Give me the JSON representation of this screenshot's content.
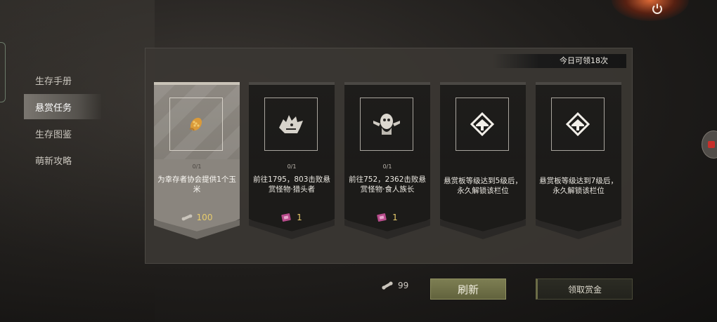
{
  "menu": {
    "items": [
      {
        "label": "生存手册",
        "active": false
      },
      {
        "label": "悬赏任务",
        "active": true
      },
      {
        "label": "生存图鉴",
        "active": false
      },
      {
        "label": "萌新攻略",
        "active": false
      }
    ]
  },
  "panel": {
    "quota_text": "今日可领18次",
    "cards": [
      {
        "style": "light",
        "icon": "corn-icon",
        "progress": "0/1",
        "description": "为幸存者协会提供1个玉米",
        "reward_icon": "bone-coin-icon",
        "reward_value": "100"
      },
      {
        "style": "dark",
        "icon": "beast-monster-icon",
        "progress": "0/1",
        "description": "前往1795，803击败悬赏怪物·猎头者",
        "reward_icon": "bounty-ticket-icon",
        "reward_value": "1"
      },
      {
        "style": "dark",
        "icon": "masked-chief-icon",
        "progress": "0/1",
        "description": "前往752，2362击败悬赏怪物·食人族长",
        "reward_icon": "bounty-ticket-icon",
        "reward_value": "1"
      },
      {
        "style": "dark",
        "icon": "locked-slot-icon",
        "progress": "",
        "description": "悬赏板等级达到5级后，永久解锁该栏位",
        "reward_icon": "",
        "reward_value": ""
      },
      {
        "style": "dark",
        "icon": "locked-slot-icon",
        "progress": "",
        "description": "悬赏板等级达到7级后，永久解锁该栏位",
        "reward_icon": "",
        "reward_value": ""
      }
    ]
  },
  "bottom": {
    "coin_value": "99",
    "refresh_label": "刷新",
    "claim_label": "领取赏金"
  },
  "colors": {
    "accent_gold": "#e8cc6c",
    "refresh_green": "#6e6f45",
    "panel_bg": "#3a3733"
  }
}
